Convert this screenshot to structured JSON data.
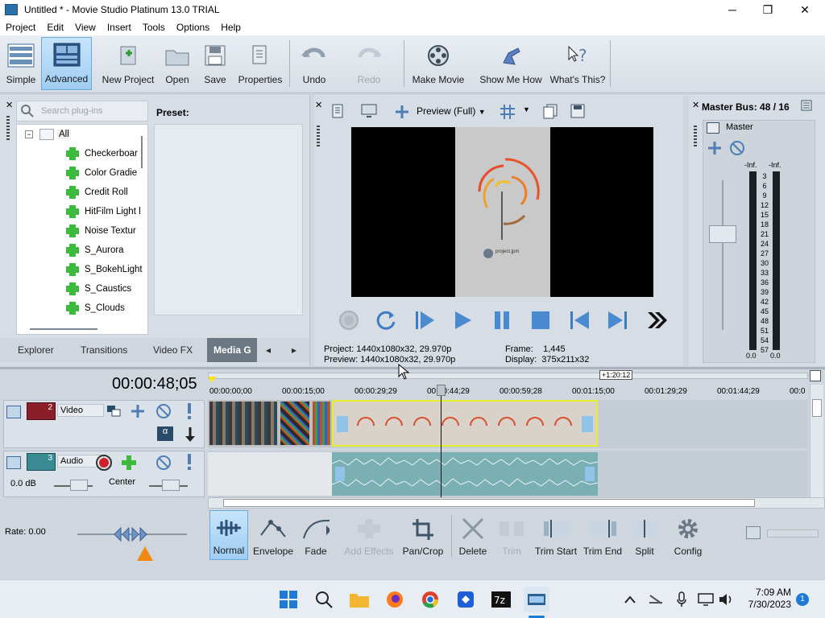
{
  "window": {
    "title": "Untitled * - Movie Studio Platinum 13.0 TRIAL",
    "minimize": "─",
    "maximize": "❐",
    "close": "✕"
  },
  "menu": [
    "Project",
    "Edit",
    "View",
    "Insert",
    "Tools",
    "Options",
    "Help"
  ],
  "toolbar": {
    "simple": "Simple",
    "advanced": "Advanced",
    "new_project": "New Project",
    "open": "Open",
    "save": "Save",
    "properties": "Properties",
    "undo": "Undo",
    "redo": "Redo",
    "make_movie": "Make Movie",
    "show_me_how": "Show Me How",
    "whats_this": "What's This?"
  },
  "plugins": {
    "search_placeholder": "Search plug-ins",
    "root": "All",
    "items": [
      "Checkerboar",
      "Color Gradie",
      "Credit Roll",
      "HitFilm Light l",
      "Noise Textur",
      "S_Aurora",
      "S_BokehLight",
      "S_Caustics",
      "S_Clouds"
    ],
    "preset_label": "Preset:"
  },
  "bottom_tabs": [
    "Explorer",
    "Transitions",
    "Video FX",
    "Media G"
  ],
  "preview": {
    "mode": "Preview (Full)",
    "project_label": "Project:",
    "project_value": "1440x1080x32, 29.970p",
    "preview_label": "Preview:",
    "preview_value": "1440x1080x32, 29.970p",
    "frame_label": "Frame:",
    "frame_value": "1,445",
    "display_label": "Display:",
    "display_value": "375x211x32",
    "watermark": "project.jpm"
  },
  "master": {
    "title": "Master Bus: 48 / 16",
    "name": "Master",
    "peak_left": "-Inf.",
    "peak_right": "-Inf.",
    "bottom_left": "0.0",
    "bottom_right": "0.0",
    "scale": [
      "3",
      "6",
      "9",
      "12",
      "15",
      "18",
      "21",
      "24",
      "27",
      "30",
      "33",
      "36",
      "39",
      "42",
      "45",
      "48",
      "51",
      "54",
      "57"
    ]
  },
  "timeline": {
    "time": "00:00:48;05",
    "loop_length": "+1:20:12",
    "ruler": [
      "00:00:00;00",
      "00:00:15;00",
      "00:00:29;29",
      "00:00:44;29",
      "00:00:59;28",
      "00:01:15;00",
      "00:01:29;29",
      "00:01:44;29",
      "00:0"
    ],
    "video_track": {
      "number": "2",
      "name": "Video"
    },
    "audio_track": {
      "number": "3",
      "name": "Audio",
      "volume": "0.0 dB",
      "pan": "Center"
    },
    "rate": "Rate: 0.00"
  },
  "edit_tools": {
    "normal": "Normal",
    "envelope": "Envelope",
    "fade": "Fade",
    "add_effects": "Add Effects",
    "pan_crop": "Pan/Crop",
    "delete": "Delete",
    "trim": "Trim",
    "trim_start": "Trim Start",
    "trim_end": "Trim End",
    "split": "Split",
    "config": "Config"
  },
  "taskbar": {
    "time": "7:09 AM",
    "date": "7/30/2023",
    "notifications": "1"
  }
}
